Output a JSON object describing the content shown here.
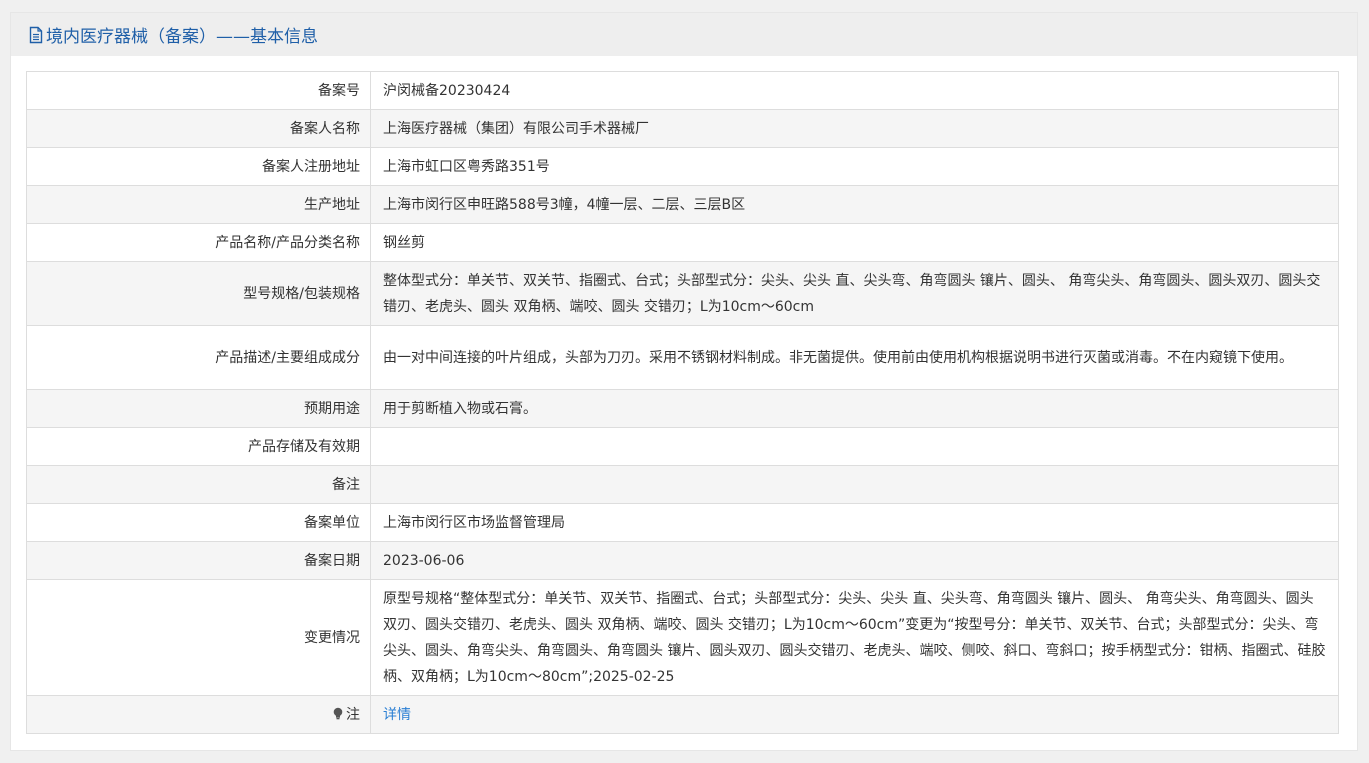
{
  "header": {
    "title": "境内医疗器械（备案）——基本信息",
    "accent_color": "#1f5fa8",
    "icon": "document-icon"
  },
  "rows": [
    {
      "label": "备案号",
      "value": "沪闵械备20230424"
    },
    {
      "label": "备案人名称",
      "value": "上海医疗器械（集团）有限公司手术器械厂"
    },
    {
      "label": "备案人注册地址",
      "value": "上海市虹口区粤秀路351号"
    },
    {
      "label": "生产地址",
      "value": "上海市闵行区申旺路588号3幢，4幢一层、二层、三层B区"
    },
    {
      "label": "产品名称/产品分类名称",
      "value": "钢丝剪"
    },
    {
      "label": "型号规格/包装规格",
      "value": "整体型式分：单关节、双关节、指圈式、台式；头部型式分：尖头、尖头 直、尖头弯、角弯圆头 镶片、圆头、 角弯尖头、角弯圆头、圆头双刃、圆头交错刃、老虎头、圆头 双角柄、端咬、圆头 交错刃；L为10cm～60cm"
    },
    {
      "label": "产品描述/主要组成成分",
      "value": "由一对中间连接的叶片组成，头部为刀刃。采用不锈钢材料制成。非无菌提供。使用前由使用机构根据说明书进行灭菌或消毒。不在内窥镜下使用。"
    },
    {
      "label": "预期用途",
      "value": "用于剪断植入物或石膏。"
    },
    {
      "label": "产品存储及有效期",
      "value": ""
    },
    {
      "label": "备注",
      "value": ""
    },
    {
      "label": "备案单位",
      "value": "上海市闵行区市场监督管理局"
    },
    {
      "label": "备案日期",
      "value": "2023-06-06"
    },
    {
      "label": "变更情况",
      "value": "原型号规格“整体型式分：单关节、双关节、指圈式、台式；头部型式分：尖头、尖头 直、尖头弯、角弯圆头 镶片、圆头、 角弯尖头、角弯圆头、圆头双刃、圆头交错刃、老虎头、圆头 双角柄、端咬、圆头 交错刃；L为10cm～60cm”变更为“按型号分：单关节、双关节、台式；头部型式分：尖头、弯尖头、圆头、角弯尖头、角弯圆头、角弯圆头 镶片、圆头双刃、圆头交错刃、老虎头、端咬、侧咬、斜口、弯斜口；按手柄型式分：钳柄、指圈式、硅胶柄、双角柄；L为10cm～80cm”;2025-02-25"
    }
  ],
  "note": {
    "label": "注",
    "icon": "lightbulb-icon",
    "link_text": "详情",
    "link_color": "#2a7fd4"
  }
}
